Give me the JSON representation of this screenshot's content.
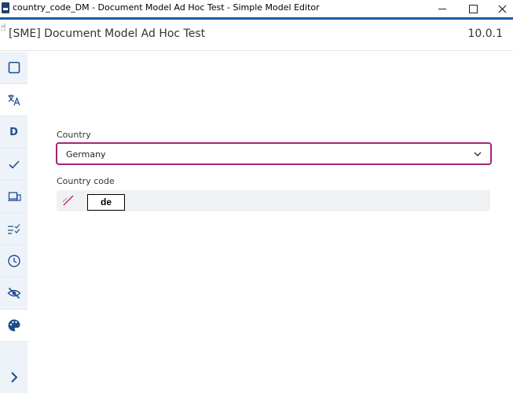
{
  "window": {
    "title": "country_code_DM - Document Model Ad Hoc Test - Simple Model Editor",
    "icon": "app-icon",
    "controls": [
      "minimize-icon",
      "maximize-icon",
      "close-icon"
    ]
  },
  "header": {
    "title": "[SME] Document Model Ad Hoc Test",
    "version": "10.0.1"
  },
  "sidebar": {
    "items": [
      {
        "icon": "square-icon"
      },
      {
        "icon": "translate-icon"
      },
      {
        "icon": "d-letter-icon",
        "label": "D"
      },
      {
        "icon": "check-icon"
      },
      {
        "icon": "devices-icon"
      },
      {
        "icon": "checklist-icon"
      },
      {
        "icon": "clock-icon"
      },
      {
        "icon": "eye-off-icon"
      },
      {
        "icon": "palette-icon"
      },
      {
        "icon": "chevron-right-icon"
      }
    ]
  },
  "form": {
    "country_label": "Country",
    "country_value": "Germany",
    "code_label": "Country code",
    "code_value": "de"
  },
  "colors": {
    "accent": "#1f5aa6",
    "focus_border": "#a0267a",
    "sidebar_bg": "#eef3f9",
    "icon": "#1f4e8c"
  }
}
